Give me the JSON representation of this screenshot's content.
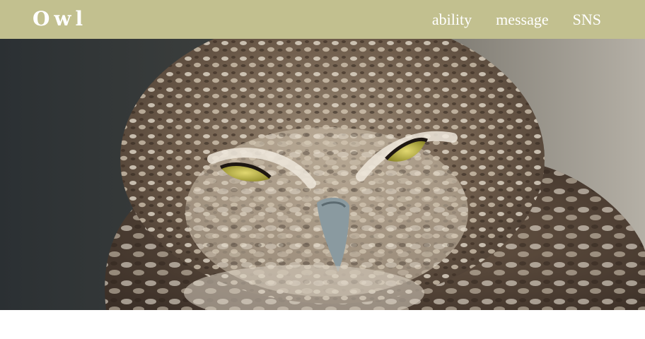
{
  "header": {
    "logo_text": "Owl",
    "background_color": "#c2c08f",
    "nav": [
      {
        "label": "ability"
      },
      {
        "label": "message"
      },
      {
        "label": "SNS"
      }
    ]
  },
  "hero": {
    "image_subject": "owl-photo",
    "eye_color": "#c9c24a"
  }
}
